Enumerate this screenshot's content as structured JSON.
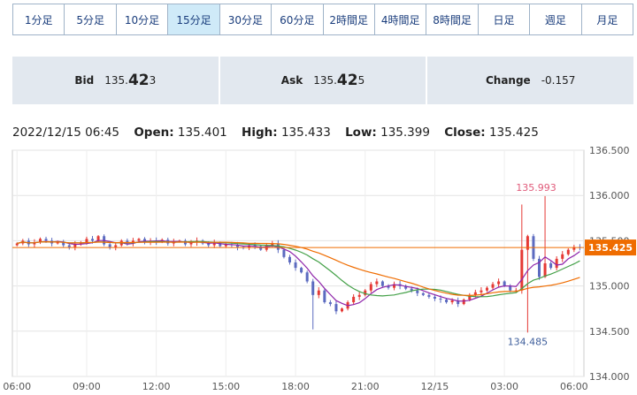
{
  "tabs": [
    {
      "label": "1分足",
      "active": false
    },
    {
      "label": "5分足",
      "active": false
    },
    {
      "label": "10分足",
      "active": false
    },
    {
      "label": "15分足",
      "active": true
    },
    {
      "label": "30分足",
      "active": false
    },
    {
      "label": "60分足",
      "active": false
    },
    {
      "label": "2時間足",
      "active": false
    },
    {
      "label": "4時間足",
      "active": false
    },
    {
      "label": "8時間足",
      "active": false
    },
    {
      "label": "日足",
      "active": false
    },
    {
      "label": "週足",
      "active": false
    },
    {
      "label": "月足",
      "active": false
    }
  ],
  "quote": {
    "bid_label": "Bid",
    "bid_prefix": "135.",
    "bid_big": "42",
    "bid_suffix": "3",
    "ask_label": "Ask",
    "ask_prefix": "135.",
    "ask_big": "42",
    "ask_suffix": "5",
    "change_label": "Change",
    "change_value": "-0.157"
  },
  "ohlc": {
    "datetime": "2022/12/15 06:45",
    "open_label": "Open:",
    "open": "135.401",
    "high_label": "High:",
    "high": "135.433",
    "low_label": "Low:",
    "low": "135.399",
    "close_label": "Close:",
    "close": "135.425"
  },
  "colors": {
    "up": "#e53935",
    "down": "#5c6bc0",
    "ma_fast": "#8e24aa",
    "ma_mid": "#43a047",
    "ma_slow": "#ef6c00",
    "price_line": "#ef6c00",
    "high_label": "#e05a7a",
    "low_label": "#3f5f9c"
  },
  "chart_data": {
    "type": "candlestick",
    "interval": "15分足",
    "ylim": [
      134.0,
      136.5
    ],
    "yticks": [
      "136.500",
      "136.000",
      "135.500",
      "135.000",
      "134.500",
      "134.000"
    ],
    "xticks": [
      {
        "label": "06:00",
        "t": 0
      },
      {
        "label": "09:00",
        "t": 12
      },
      {
        "label": "12:00",
        "t": 24
      },
      {
        "label": "15:00",
        "t": 36
      },
      {
        "label": "18:00",
        "t": 48
      },
      {
        "label": "21:00",
        "t": 60
      },
      {
        "label": "12/15",
        "t": 72
      },
      {
        "label": "03:00",
        "t": 84
      },
      {
        "label": "06:00",
        "t": 96
      }
    ],
    "last_price": "135.425",
    "high_annotation": {
      "value": "135.993",
      "t": 91
    },
    "low_annotation": {
      "value": "134.485",
      "t": 88
    },
    "candles_close": [
      135.47,
      135.5,
      135.46,
      135.48,
      135.52,
      135.5,
      135.47,
      135.49,
      135.45,
      135.43,
      135.46,
      135.48,
      135.52,
      135.5,
      135.55,
      135.46,
      135.43,
      135.45,
      135.5,
      135.47,
      135.5,
      135.52,
      135.48,
      135.5,
      135.49,
      135.51,
      135.47,
      135.49,
      135.5,
      135.46,
      135.48,
      135.5,
      135.47,
      135.45,
      135.48,
      135.44,
      135.46,
      135.45,
      135.43,
      135.42,
      135.45,
      135.44,
      135.4,
      135.45,
      135.47,
      135.4,
      135.32,
      135.26,
      135.2,
      135.15,
      135.05,
      134.9,
      134.95,
      134.82,
      134.8,
      134.72,
      134.75,
      134.82,
      134.88,
      134.9,
      134.95,
      135.02,
      135.05,
      135.0,
      134.98,
      135.02,
      135.0,
      134.97,
      134.95,
      134.92,
      134.9,
      134.88,
      134.86,
      134.85,
      134.82,
      134.84,
      134.8,
      134.85,
      134.9,
      134.93,
      134.95,
      134.98,
      135.02,
      135.05,
      135.0,
      134.95,
      134.95,
      135.4,
      135.55,
      135.3,
      135.1,
      135.25,
      135.2,
      135.3,
      135.35,
      135.4,
      135.43,
      135.425
    ],
    "ma": [
      {
        "name": "ma_fast",
        "period": 5
      },
      {
        "name": "ma_mid",
        "period": 13
      },
      {
        "name": "ma_slow",
        "period": 26
      }
    ]
  }
}
